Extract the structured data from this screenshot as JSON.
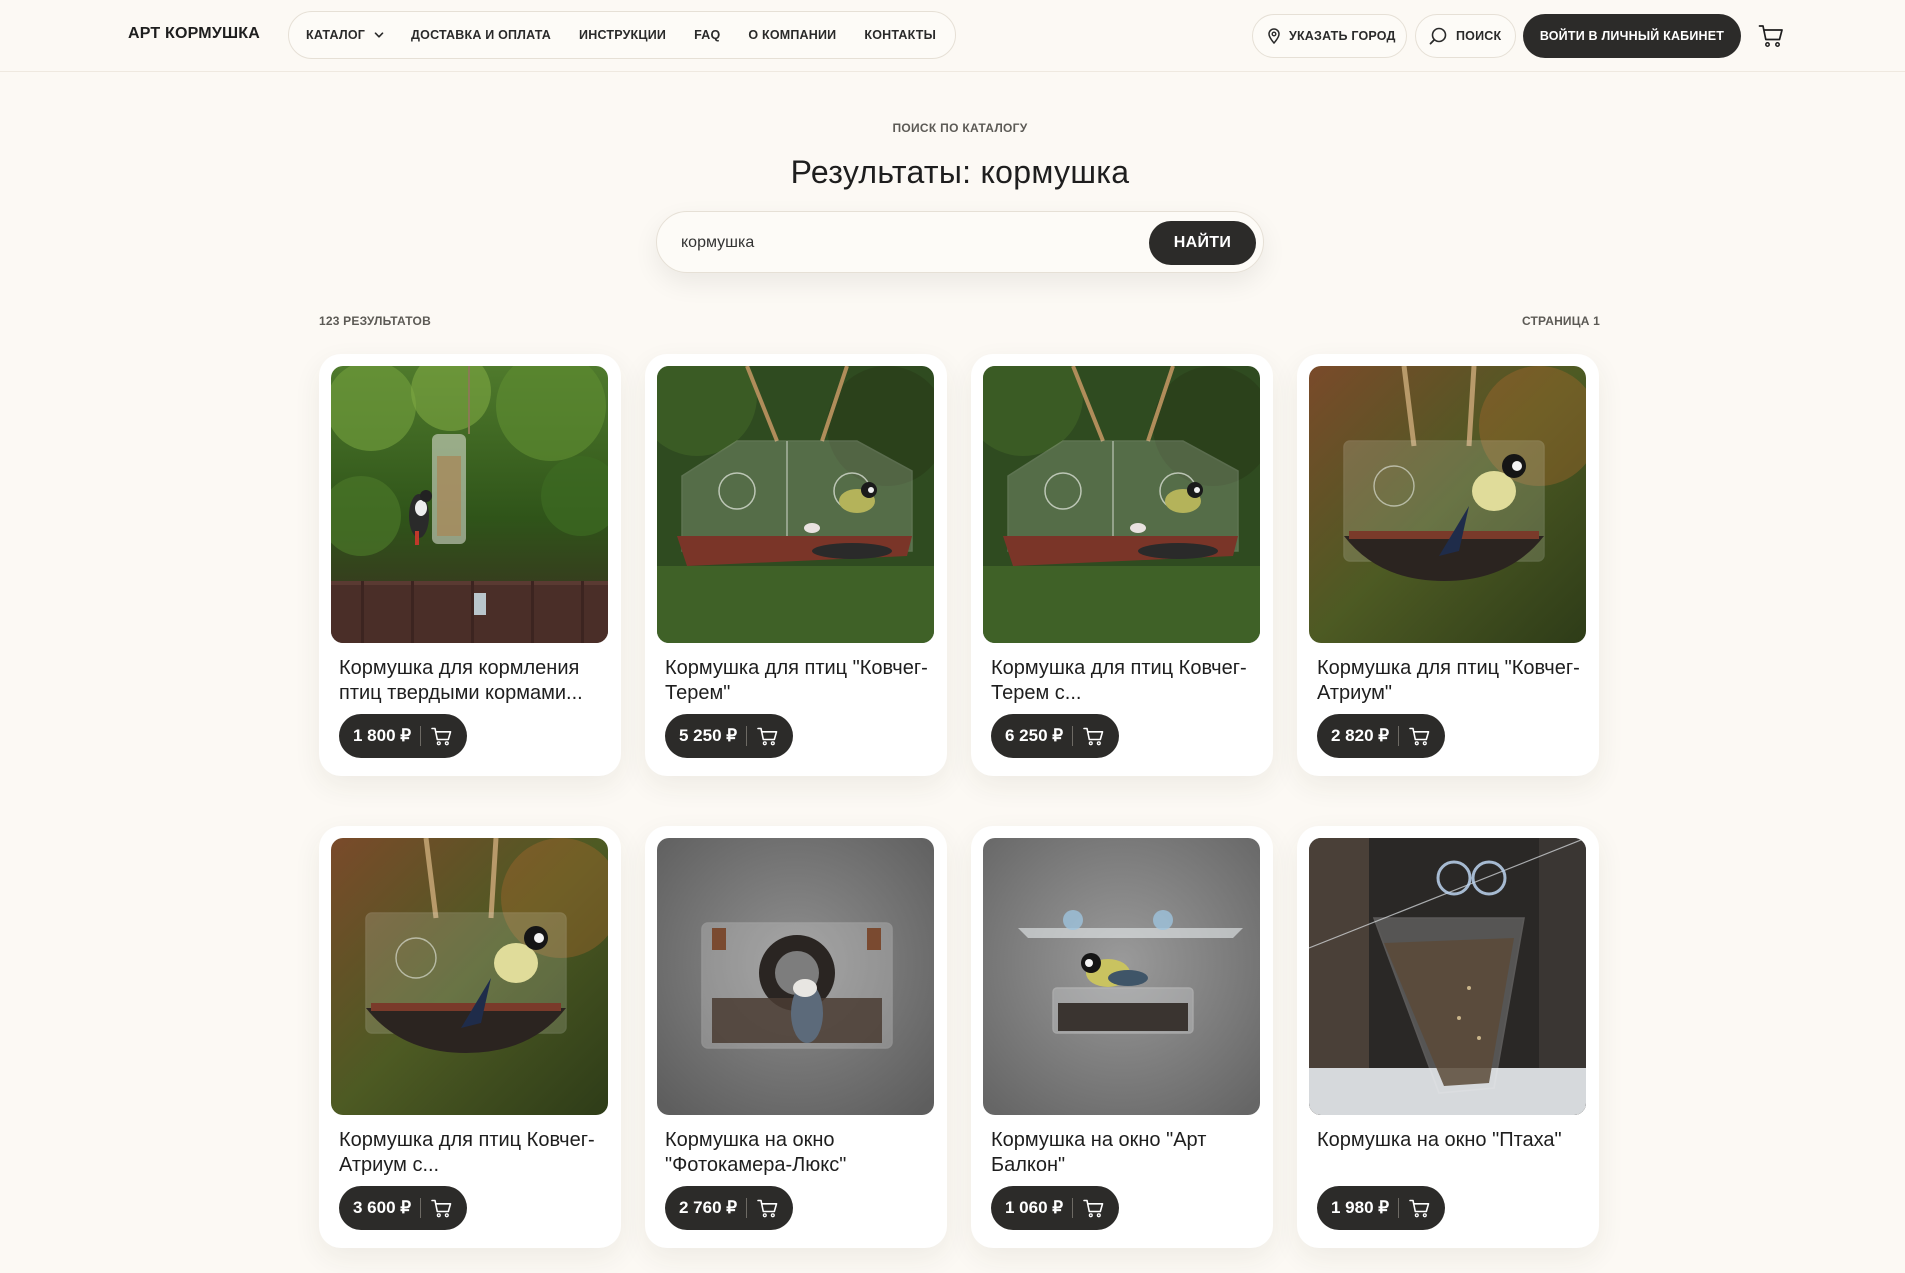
{
  "header": {
    "logo": "АРТ КОРМУШКА",
    "nav": [
      {
        "label": "КАТАЛОГ",
        "has_dropdown": true
      },
      {
        "label": "ДОСТАВКА И ОПЛАТА"
      },
      {
        "label": "ИНСТРУКЦИИ"
      },
      {
        "label": "FAQ"
      },
      {
        "label": "О КОМПАНИИ"
      },
      {
        "label": "КОНТАКТЫ"
      }
    ],
    "city_label": "УКАЗАТЬ ГОРОД",
    "search_label": "ПОИСК",
    "login_label": "ВОЙТИ В ЛИЧНЫЙ КАБИНЕТ",
    "icons": [
      "chevron-down-icon",
      "location-pin-icon",
      "search-icon",
      "cart-icon"
    ]
  },
  "search": {
    "eyebrow": "ПОИСК ПО КАТАЛОГУ",
    "title": "Результаты: кормушка",
    "query": "кормушка",
    "button": "НАЙТИ"
  },
  "results": {
    "count_label": "123 РЕЗУЛЬТАТОВ",
    "page_label": "СТРАНИЦА 1"
  },
  "products": [
    {
      "name": "Кормушка для кормления птиц твердыми кормами...",
      "price": "1 800 ₽",
      "image": "woodpecker-tube-feeder"
    },
    {
      "name": "Кормушка для птиц \"Ковчег-Терем\"",
      "price": "5 250 ₽",
      "image": "house-feeder-tit"
    },
    {
      "name": "Кормушка для птиц Ковчег-Терем с...",
      "price": "6 250 ₽",
      "image": "house-feeder-tit"
    },
    {
      "name": "Кормушка для птиц \"Ковчег-Атриум\"",
      "price": "2 820 ₽",
      "image": "atrium-feeder-tit"
    },
    {
      "name": "Кормушка для птиц Ковчег-Атриум с...",
      "price": "3 600 ₽",
      "image": "atrium-feeder-tit"
    },
    {
      "name": "Кормушка на окно \"Фотокамера-Люкс\"",
      "price": "2 760 ₽",
      "image": "window-camera-feeder-nuthatch"
    },
    {
      "name": "Кормушка на окно \"Арт Балкон\"",
      "price": "1 060 ₽",
      "image": "window-balcony-feeder-tit"
    },
    {
      "name": "Кормушка на окно \"Птаха\"",
      "price": "1 980 ₽",
      "image": "window-ptaha-feeder"
    }
  ],
  "colors": {
    "background": "#fcf9f4",
    "dark_button": "#2c2b29",
    "card": "#ffffff"
  }
}
